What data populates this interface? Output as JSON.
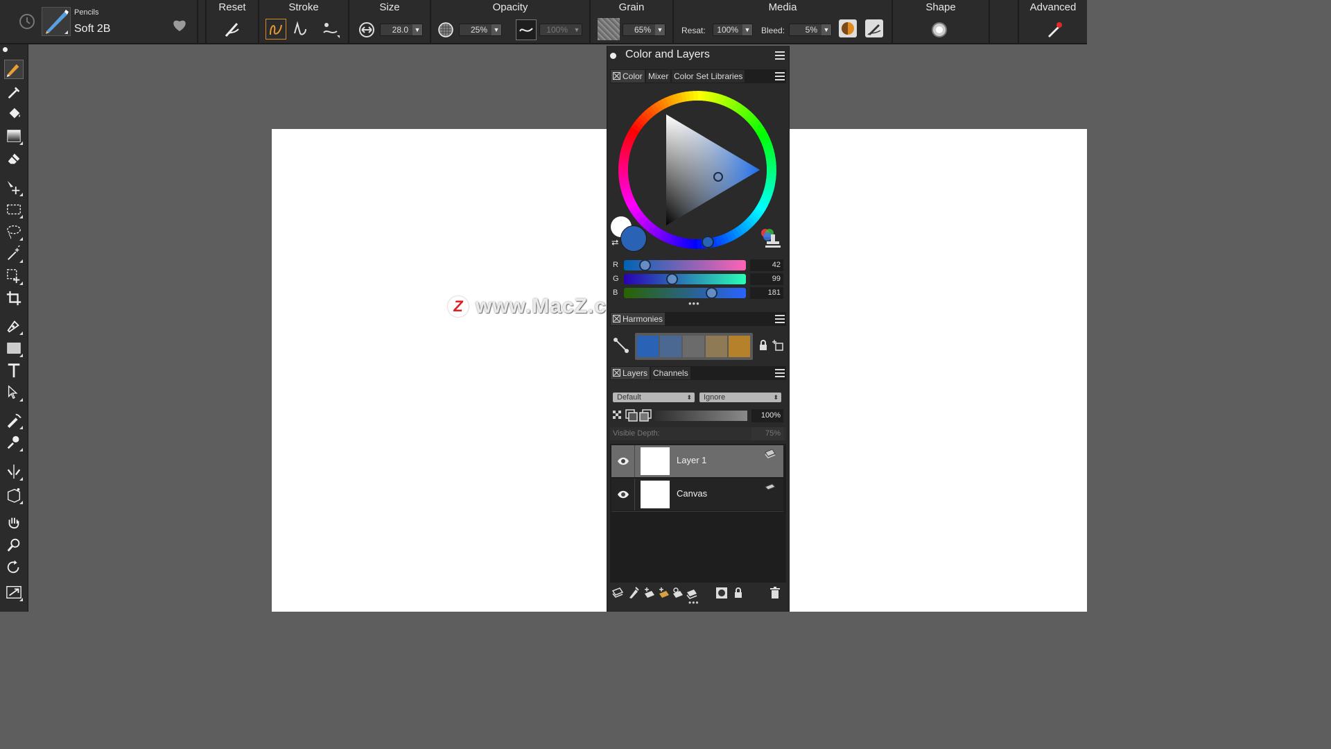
{
  "brush": {
    "category": "Pencils",
    "variant": "Soft 2B",
    "icons": {
      "history": "history-icon",
      "brush": "pencil-brush-icon",
      "favorite": "heart-icon"
    }
  },
  "sections": {
    "reset": "Reset",
    "stroke": "Stroke",
    "size": "Size",
    "opacity": "Opacity",
    "grain": "Grain",
    "media": "Media",
    "shape": "Shape",
    "advanced": "Advanced"
  },
  "values": {
    "size": "28.0",
    "opacity": "25%",
    "opacity_expression": "100%",
    "grain": "65%",
    "resat_label": "Resat:",
    "resat": "100%",
    "bleed_label": "Bleed:",
    "bleed": "5%"
  },
  "tools": [
    "brush-tool",
    "dropper-tool",
    "paint-bucket-tool",
    "gradient-tool",
    "eraser-tool",
    "layer-adjuster-tool",
    "rectangular-selection-tool",
    "lasso-tool",
    "magic-wand-tool",
    "transform-tool",
    "crop-tool",
    "pen-tool",
    "rectangle-shape-tool",
    "text-tool",
    "selection-adjuster-tool",
    "blender-tool",
    "cloner-tool",
    "mirror-painting-tool",
    "perspective-guides-tool",
    "grabber-tool",
    "magnifier-tool",
    "rotate-page-tool",
    "fit-screen-tool"
  ],
  "watermark": {
    "badge": "Z",
    "text": "www.MacZ.com"
  },
  "panel": {
    "title": "Color and Layers",
    "color_tabs": [
      "Color",
      "Mixer",
      "Color Set Libraries"
    ],
    "rgb": {
      "r_label": "R",
      "g_label": "G",
      "b_label": "B",
      "r": "42",
      "g": "99",
      "b": "181",
      "r_fraction": 0.165,
      "g_fraction": 0.388,
      "b_fraction": 0.71
    },
    "main_color": "#2a63b5",
    "secondary_color": "#ffffff",
    "harmonies_tab": "Harmonies",
    "harmony_swatches": [
      "#2a63b5",
      "#4a6892",
      "#6b6b6b",
      "#8e7a55",
      "#b5812a"
    ],
    "layers_tabs": [
      "Layers",
      "Channels"
    ],
    "composite_method": "Default",
    "composite_depth": "Ignore",
    "layer_opacity": "100%",
    "visible_depth_label": "Visible Depth:",
    "visible_depth": "75%",
    "layers": [
      {
        "name": "Layer 1",
        "type": "transparent"
      },
      {
        "name": "Canvas",
        "type": "white"
      }
    ]
  }
}
